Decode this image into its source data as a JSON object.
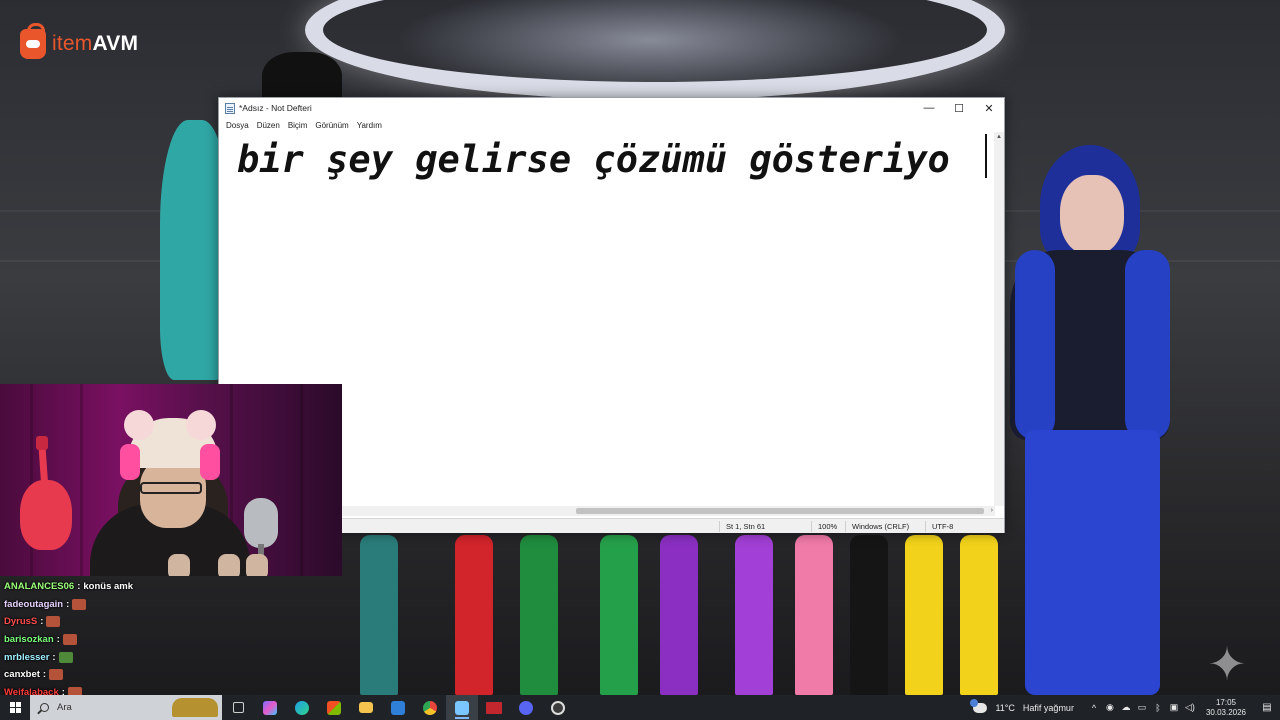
{
  "brand": {
    "name_part1": "item",
    "name_part2": "AVM"
  },
  "notepad": {
    "title": "*Adsız - Not Defteri",
    "menu": [
      "Dosya",
      "Düzen",
      "Biçim",
      "Görünüm",
      "Yardım"
    ],
    "content": "bir şey gelirse çözümü gösteriyo",
    "status": {
      "position": "St 1, Stn 61",
      "zoom": "100%",
      "line_endings": "Windows (CRLF)",
      "encoding": "UTF-8"
    },
    "controls": {
      "minimize": "—",
      "maximize": "☐",
      "close": "✕"
    }
  },
  "chat": {
    "messages": [
      {
        "user": "ANALANCES06",
        "color": "#9cff7a",
        "text": "konüs amk",
        "emote": ""
      },
      {
        "user": "fadeoutagain",
        "color": "#e9d3ff",
        "text": "",
        "emote": "#b5523a"
      },
      {
        "user": "DyrusS",
        "color": "#ff4d4d",
        "text": "",
        "emote": "#b5523a"
      },
      {
        "user": "barisozkan",
        "color": "#7dff7d",
        "text": "",
        "emote": "#b5523a"
      },
      {
        "user": "mrblesser",
        "color": "#9ff0ff",
        "text": "",
        "emote": "#4f8a3a"
      },
      {
        "user": "canxbet",
        "color": "#ffffff",
        "text": "",
        "emote": "#b5523a"
      },
      {
        "user": "Wejfalaback",
        "color": "#ff3b3b",
        "text": "",
        "emote": "#b5523a"
      }
    ]
  },
  "taskbar": {
    "search_placeholder": "Ara",
    "apps": [
      {
        "name": "task-view-icon",
        "color": "#cfcfcf",
        "active": false
      },
      {
        "name": "copilot-icon",
        "color": "#7a6cff",
        "active": false
      },
      {
        "name": "edge-icon",
        "color": "#1fa2e6",
        "active": false
      },
      {
        "name": "store-icon",
        "color": "#f2c14e",
        "active": false
      },
      {
        "name": "file-explorer-icon",
        "color": "#f4c44e",
        "active": false
      },
      {
        "name": "outlook-icon",
        "color": "#2f7fd8",
        "active": false
      },
      {
        "name": "chrome-icon",
        "color": "#e8453c",
        "active": false
      },
      {
        "name": "notepad-icon",
        "color": "#7cc6ff",
        "active": true
      },
      {
        "name": "voice-meter-icon",
        "color": "#c2272d",
        "active": false
      },
      {
        "name": "discord-icon",
        "color": "#5865f2",
        "active": false
      },
      {
        "name": "obs-icon",
        "color": "#3c3c3c",
        "active": false
      }
    ],
    "weather": {
      "temp": "11°C",
      "desc": "Hafif yağmur"
    },
    "clock": {
      "time": "17:05",
      "date": "30.03.2026"
    }
  }
}
